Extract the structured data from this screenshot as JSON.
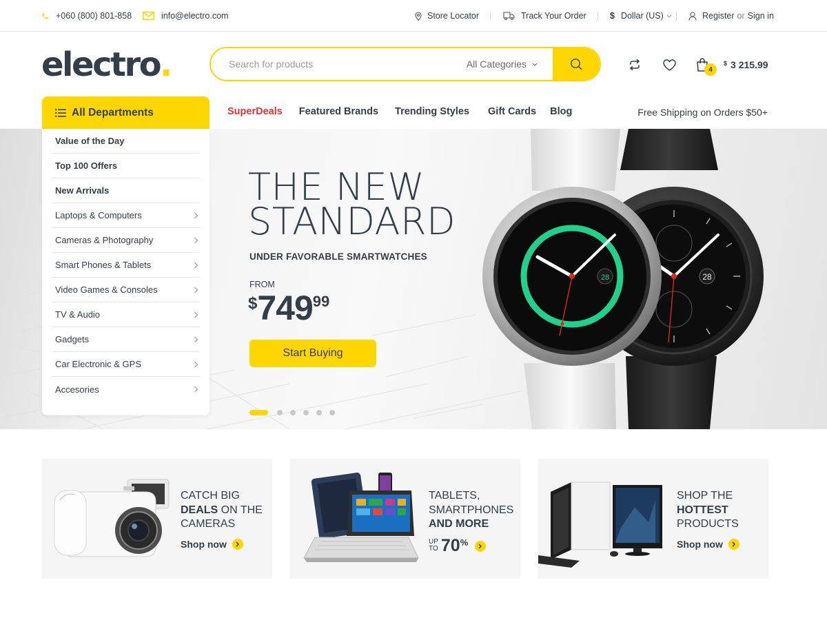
{
  "topbar": {
    "phone": "+060 (800) 801-858",
    "email": "info@electro.com",
    "store_locator": "Store Locator",
    "track_order": "Track Your Order",
    "currency_symbol": "$",
    "currency": "Dollar (US)",
    "register": "Register",
    "or": "or",
    "sign_in": "Sign in"
  },
  "header": {
    "logo_text": "electro",
    "logo_dot": ".",
    "search_placeholder": "Search for products",
    "category_select": "All Categories",
    "cart_count": "4",
    "cart_currency": "$",
    "cart_total": "3 215.99"
  },
  "nav": {
    "departments_label": "All Departments",
    "links": [
      "SuperDeals",
      "Featured Brands",
      "Trending Styles",
      "Gift Cards",
      "Blog"
    ],
    "free_shipping": "Free Shipping on Orders $50+"
  },
  "departments": [
    {
      "label": "Value of the Day",
      "bold": true
    },
    {
      "label": "Top 100 Offers",
      "bold": true
    },
    {
      "label": "New Arrivals",
      "bold": true
    },
    {
      "label": "Laptops & Computers",
      "bold": false
    },
    {
      "label": "Cameras & Photography",
      "bold": false
    },
    {
      "label": "Smart Phones & Tablets",
      "bold": false
    },
    {
      "label": "Video Games & Consoles",
      "bold": false
    },
    {
      "label": "TV & Audio",
      "bold": false
    },
    {
      "label": "Gadgets",
      "bold": false
    },
    {
      "label": "Car Electronic & GPS",
      "bold": false
    },
    {
      "label": "Accesories",
      "bold": false
    }
  ],
  "hero": {
    "title_line1": "THE NEW",
    "title_line2": "STANDARD",
    "subtitle": "UNDER FAVORABLE SMARTWATCHES",
    "from": "FROM",
    "price_currency": "$",
    "price_int": "749",
    "price_dec": "99",
    "cta": "Start Buying",
    "watch_date": "28",
    "slide_count": 6,
    "active_slide": 1
  },
  "promos": [
    {
      "line1": "CATCH BIG",
      "bold": "DEALS",
      "line2_rest": " ON THE",
      "line3": "CAMERAS",
      "link": "Shop now"
    },
    {
      "line1": "TABLETS,",
      "line2": "SMARTPHONES",
      "bold": "AND MORE",
      "upto": "UP",
      "to": "TO",
      "percent": "70",
      "pct_sign": "%"
    },
    {
      "line1": "SHOP THE",
      "bold": "HOTTEST",
      "line3": "PRODUCTS",
      "link": "Shop now"
    }
  ],
  "colors": {
    "accent": "#fed700",
    "text": "#333e48",
    "hot": "#df3737"
  }
}
